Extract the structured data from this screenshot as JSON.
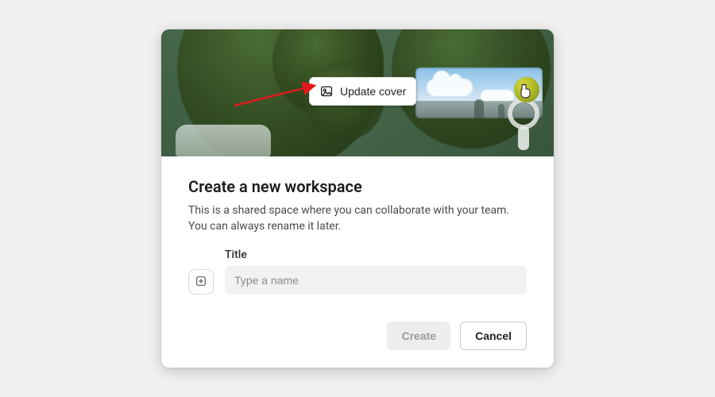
{
  "cover": {
    "update_label": "Update cover",
    "image_icon": "image-icon"
  },
  "dialog": {
    "heading": "Create a new workspace",
    "description_line1": "This is a shared space where you can collaborate with your team.",
    "description_line2": "You can always rename it later.",
    "title_label": "Title",
    "title_placeholder": "Type a name",
    "title_value": "",
    "add_icon": "plus-icon"
  },
  "actions": {
    "create_label": "Create",
    "cancel_label": "Cancel",
    "create_disabled": true
  },
  "annotation": {
    "arrow_color": "#e11b1b"
  }
}
